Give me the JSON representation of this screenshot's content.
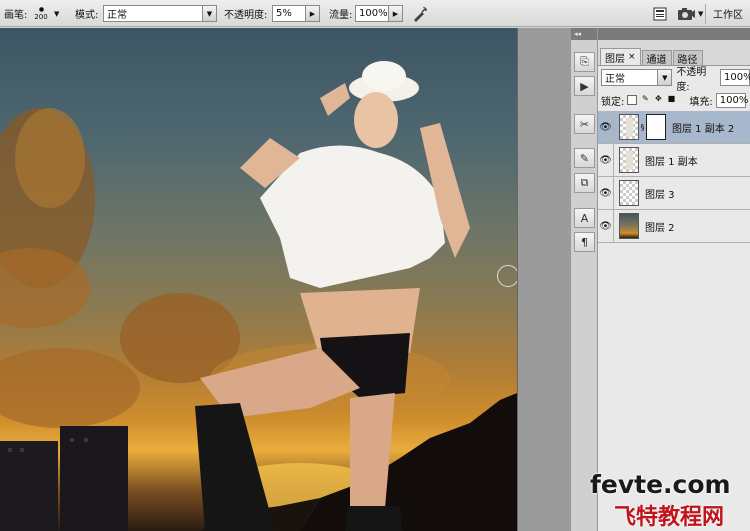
{
  "options_bar": {
    "brush_label": "画笔:",
    "brush_size": "200",
    "mode_label": "模式:",
    "mode_value": "正常",
    "opacity_label": "不透明度:",
    "opacity_value": "5%",
    "flow_label": "流量:",
    "flow_value": "100%",
    "workspace_label": "工作区"
  },
  "tool_strip": {
    "collapse_label": "◂◂",
    "items": [
      "history-icon",
      "actions-icon",
      "tool-presets-icon",
      "brushes-icon",
      "clone-source-icon",
      "character-icon",
      "paragraph-icon"
    ]
  },
  "layers_panel": {
    "tabs": [
      {
        "label": "图层",
        "active": true
      },
      {
        "label": "通道",
        "active": false
      },
      {
        "label": "路径",
        "active": false
      }
    ],
    "blend_mode": "正常",
    "opacity_label": "不透明度:",
    "opacity_value": "100%",
    "lock_label": "锁定:",
    "fill_label": "填充:",
    "fill_value": "100%",
    "layers": [
      {
        "name": "图层 1 副本 2",
        "visible": true,
        "selected": true,
        "has_mask": true
      },
      {
        "name": "图层 1 副本",
        "visible": true,
        "selected": false,
        "has_mask": false
      },
      {
        "name": "图层 3",
        "visible": true,
        "selected": false,
        "has_mask": false
      },
      {
        "name": "图层 2",
        "visible": true,
        "selected": false,
        "has_mask": false
      }
    ]
  },
  "watermark": {
    "line1": "fevte.com",
    "line2": "飞特教程网"
  },
  "colors": {
    "selected_layer": "#a8b8cc",
    "watermark_red": "#c0141a"
  }
}
